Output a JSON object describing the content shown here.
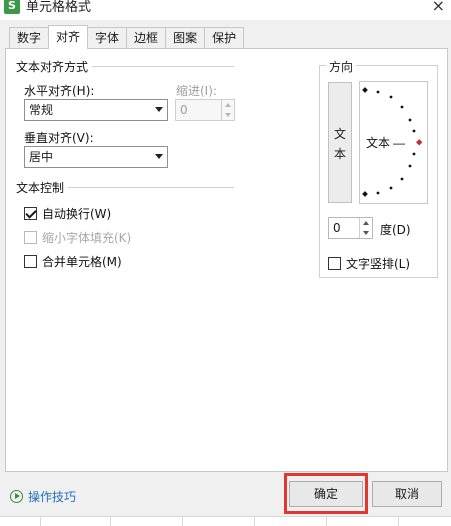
{
  "window": {
    "app_icon": "S",
    "title": "单元格格式",
    "close": "×"
  },
  "tabs": [
    {
      "label": "数字"
    },
    {
      "label": "对齐"
    },
    {
      "label": "字体"
    },
    {
      "label": "边框"
    },
    {
      "label": "图案"
    },
    {
      "label": "保护"
    }
  ],
  "alignment": {
    "group_title": "文本对齐方式",
    "horizontal_label": "水平对齐(H):",
    "horizontal_value": "常规",
    "indent_label": "缩进(I):",
    "indent_value": "0",
    "vertical_label": "垂直对齐(V):",
    "vertical_value": "居中"
  },
  "text_control": {
    "group_title": "文本控制",
    "wrap_label": "自动换行(W)",
    "wrap_checked": true,
    "shrink_label": "缩小字体填充(K)",
    "shrink_checked": false,
    "merge_label": "合并单元格(M)",
    "merge_checked": false
  },
  "orientation": {
    "group_title": "方向",
    "vertical_text_char1": "文",
    "vertical_text_char2": "本",
    "dial_text": "文本",
    "dial_line": "—",
    "degree_value": "0",
    "degree_label": "度(D)",
    "vertical_stack_label": "文字竖排(L)",
    "vertical_stack_checked": false,
    "marker_color": "#c0303a"
  },
  "footer": {
    "tips_label": "操作技巧",
    "ok_label": "确定",
    "cancel_label": "取消"
  },
  "colors": {
    "highlight": "#e0382f",
    "link": "#1e6fc0"
  }
}
